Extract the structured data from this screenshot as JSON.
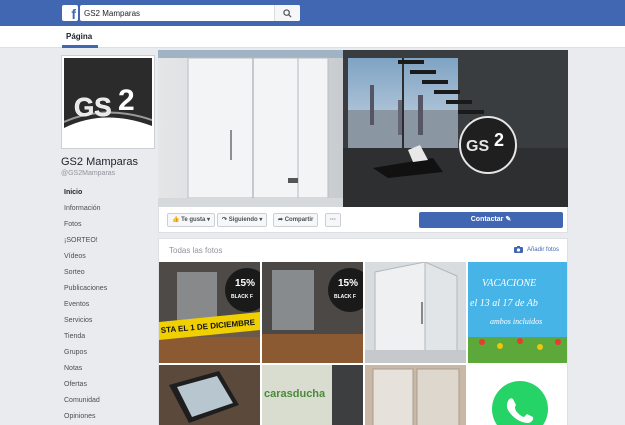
{
  "search": {
    "value": "GS2 Mamparas"
  },
  "tabs": {
    "page": "Página"
  },
  "profile": {
    "logo_text": "GS2",
    "name": "GS2 Mamparas",
    "handle": "@GS2Mamparas"
  },
  "nav": [
    "Inicio",
    "Información",
    "Fotos",
    "¡SORTEO!",
    "Vídeos",
    "Sorteo",
    "Publicaciones",
    "Eventos",
    "Servicios",
    "Tienda",
    "Grupos",
    "Notas",
    "Ofertas",
    "Comunidad",
    "Opiniones"
  ],
  "actions": {
    "like": "Te gusta ▾",
    "follow": "Siguiendo ▾",
    "share": "Compartir",
    "more": "···",
    "contact": "Contactar"
  },
  "photos": {
    "title": "Todas las fotos",
    "add": "Añadir fotos",
    "tiles": [
      {
        "badge": "15%",
        "badge_sub": "BLACK F",
        "banner": "STA EL 1 DE DICIEMBRE"
      },
      {
        "badge": "15%",
        "badge_sub": "BLACK F"
      },
      {},
      {
        "line1": "VACACIONE",
        "line2": "el 13 al 17 de Ab",
        "line3": "ambos incluidos"
      },
      {},
      {
        "brand": "carasducha"
      },
      {},
      {}
    ]
  },
  "colors": {
    "brand": "#4267b2",
    "background": "#e9ebee"
  }
}
